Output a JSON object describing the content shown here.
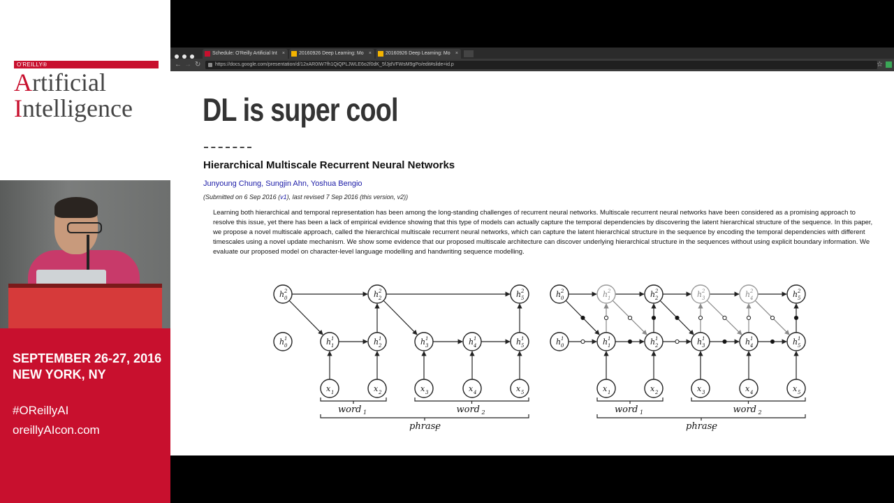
{
  "brand": {
    "publisher": "O'REILLY®",
    "title_line1_cap": "A",
    "title_line1_rest": "rtificial",
    "title_line2_cap": "I",
    "title_line2_rest": "ntelligence"
  },
  "event": {
    "dates": "SEPTEMBER 26-27, 2016",
    "location": "NEW YORK, NY",
    "hashtag": "#OReillyAI",
    "site": "oreillyAIcon.com"
  },
  "browser": {
    "tabs": [
      {
        "label": "Schedule: O'Reilly Artificial Int"
      },
      {
        "label": "20160926 Deep Learning: Mo"
      },
      {
        "label": "20160926 Deep Learning: Mo"
      }
    ],
    "close_glyph": "×",
    "back_glyph": "←",
    "forward_glyph": "→",
    "reload_glyph": "↻",
    "url": "https://docs.google.com/presentation/d/12xAR0IW7fh1QiQPLJWLE6o2f0dK_5fJjdVFWsM9gPo/edit#slide=id.p",
    "star_glyph": "☆"
  },
  "slide": {
    "title": "DL is super cool",
    "paper_title": "Hierarchical Multiscale Recurrent Neural Networks",
    "authors": "Junyoung Chung, Sungjin Ahn, Yoshua Bengio",
    "submitted_prefix": "(Submitted on 6 Sep 2016 (",
    "submitted_v1": "v1",
    "submitted_suffix": "), last revised 7 Sep 2016 (this version, v2))",
    "abstract": "Learning both hierarchical and temporal representation has been among the long-standing challenges of recurrent neural networks. Multiscale recurrent neural networks have been considered as a promising approach to resolve this issue, yet there has been a lack of empirical evidence showing that this type of models can actually capture the temporal dependencies by discovering the latent hierarchical structure of the sequence. In this paper, we propose a novel multiscale approach, called the hierarchical multiscale recurrent neural networks, which can capture the latent hierarchical structure in the sequence by encoding the temporal dependencies with different timescales using a novel update mechanism. We show some evidence that our proposed multiscale architecture can discover underlying hierarchical structure in the sequences without using explicit boundary information. We evaluate our proposed model on character-level language modelling and handwriting sequence modelling."
  },
  "diagram": {
    "h2": "h",
    "h1": "h",
    "x": "x",
    "sup2": "2",
    "sup1": "1",
    "subs": [
      "0",
      "1",
      "2",
      "3",
      "4",
      "5"
    ],
    "word": "word",
    "phrase": "phrase"
  }
}
